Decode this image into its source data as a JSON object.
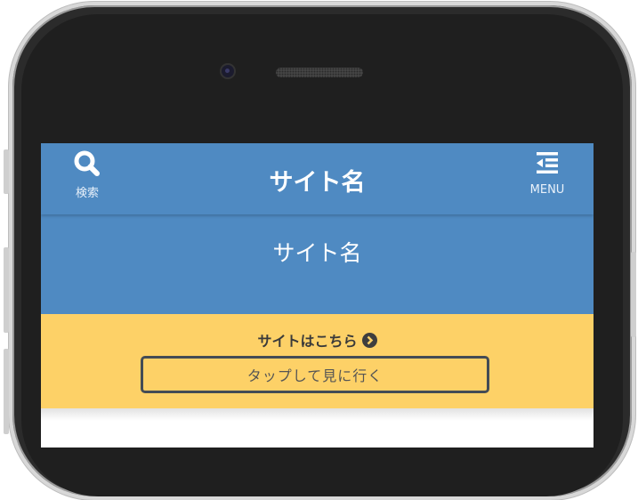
{
  "header": {
    "search_label": "検索",
    "site_title": "サイト名",
    "menu_label": "MENU"
  },
  "hero": {
    "title": "サイト名"
  },
  "banner": {
    "link_text": "サイトはこちら",
    "button_label": "タップして見に行く"
  },
  "colors": {
    "header_bg": "#4f8ac2",
    "banner_bg": "#fdd167",
    "button_border": "#444c55"
  }
}
